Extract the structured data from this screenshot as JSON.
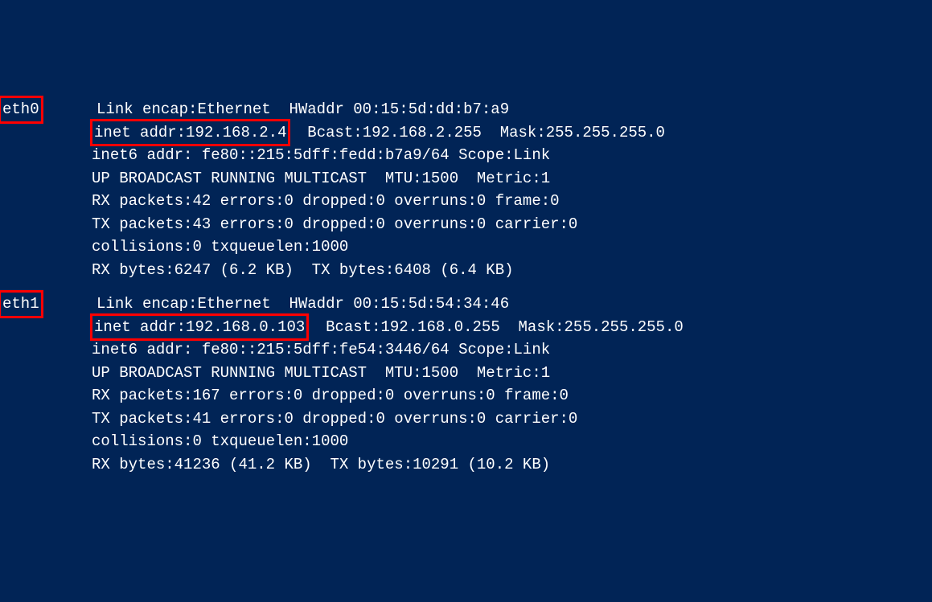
{
  "interfaces": [
    {
      "name": "eth0",
      "inet_label": "inet addr:192.168.2.4",
      "lines": {
        "l1": "Link encap:Ethernet  HWaddr 00:15:5d:dd:b7:a9",
        "l2_rest": "  Bcast:192.168.2.255  Mask:255.255.255.0",
        "l3": "inet6 addr: fe80::215:5dff:fedd:b7a9/64 Scope:Link",
        "l4": "UP BROADCAST RUNNING MULTICAST  MTU:1500  Metric:1",
        "l5": "RX packets:42 errors:0 dropped:0 overruns:0 frame:0",
        "l6": "TX packets:43 errors:0 dropped:0 overruns:0 carrier:0",
        "l7": "collisions:0 txqueuelen:1000",
        "l8": "RX bytes:6247 (6.2 KB)  TX bytes:6408 (6.4 KB)"
      }
    },
    {
      "name": "eth1",
      "inet_label": "inet addr:192.168.0.103",
      "lines": {
        "l1": "Link encap:Ethernet  HWaddr 00:15:5d:54:34:46",
        "l2_rest": "  Bcast:192.168.0.255  Mask:255.255.255.0",
        "l3": "inet6 addr: fe80::215:5dff:fe54:3446/64 Scope:Link",
        "l4": "UP BROADCAST RUNNING MULTICAST  MTU:1500  Metric:1",
        "l5": "RX packets:167 errors:0 dropped:0 overruns:0 frame:0",
        "l6": "TX packets:41 errors:0 dropped:0 overruns:0 carrier:0",
        "l7": "collisions:0 txqueuelen:1000",
        "l8": "RX bytes:41236 (41.2 KB)  TX bytes:10291 (10.2 KB)"
      }
    }
  ]
}
